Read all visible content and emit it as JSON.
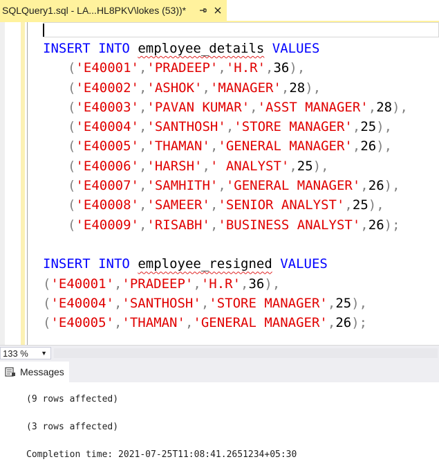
{
  "tab": {
    "title": "SQLQuery1.sql - LA...HL8PKV\\lokes (53))*",
    "pin_icon": "pin-icon",
    "close_icon": "close-icon",
    "accent": "#fff29d"
  },
  "editor": {
    "lines": [
      {
        "indent": false,
        "tokens": [
          {
            "t": "INSERT",
            "c": "kw"
          },
          {
            "t": " ",
            "c": ""
          },
          {
            "t": "INTO",
            "c": "kw"
          },
          {
            "t": " ",
            "c": ""
          },
          {
            "t": "employee_details",
            "c": "id"
          },
          {
            "t": " ",
            "c": ""
          },
          {
            "t": "VALUES",
            "c": "kw"
          }
        ]
      },
      {
        "indent": true,
        "tokens": [
          {
            "t": "(",
            "c": "op"
          },
          {
            "t": "'E40001'",
            "c": "str"
          },
          {
            "t": ",",
            "c": "op"
          },
          {
            "t": "'PRADEEP'",
            "c": "str"
          },
          {
            "t": ",",
            "c": "op"
          },
          {
            "t": "'H.R'",
            "c": "str"
          },
          {
            "t": ",",
            "c": "op"
          },
          {
            "t": "36",
            "c": "num"
          },
          {
            "t": "),",
            "c": "op"
          }
        ]
      },
      {
        "indent": true,
        "tokens": [
          {
            "t": "(",
            "c": "op"
          },
          {
            "t": "'E40002'",
            "c": "str"
          },
          {
            "t": ",",
            "c": "op"
          },
          {
            "t": "'ASHOK'",
            "c": "str"
          },
          {
            "t": ",",
            "c": "op"
          },
          {
            "t": "'MANAGER'",
            "c": "str"
          },
          {
            "t": ",",
            "c": "op"
          },
          {
            "t": "28",
            "c": "num"
          },
          {
            "t": "),",
            "c": "op"
          }
        ]
      },
      {
        "indent": true,
        "tokens": [
          {
            "t": "(",
            "c": "op"
          },
          {
            "t": "'E40003'",
            "c": "str"
          },
          {
            "t": ",",
            "c": "op"
          },
          {
            "t": "'PAVAN KUMAR'",
            "c": "str"
          },
          {
            "t": ",",
            "c": "op"
          },
          {
            "t": "'ASST MANAGER'",
            "c": "str"
          },
          {
            "t": ",",
            "c": "op"
          },
          {
            "t": "28",
            "c": "num"
          },
          {
            "t": "),",
            "c": "op"
          }
        ]
      },
      {
        "indent": true,
        "tokens": [
          {
            "t": "(",
            "c": "op"
          },
          {
            "t": "'E40004'",
            "c": "str"
          },
          {
            "t": ",",
            "c": "op"
          },
          {
            "t": "'SANTHOSH'",
            "c": "str"
          },
          {
            "t": ",",
            "c": "op"
          },
          {
            "t": "'STORE MANAGER'",
            "c": "str"
          },
          {
            "t": ",",
            "c": "op"
          },
          {
            "t": "25",
            "c": "num"
          },
          {
            "t": "),",
            "c": "op"
          }
        ]
      },
      {
        "indent": true,
        "tokens": [
          {
            "t": "(",
            "c": "op"
          },
          {
            "t": "'E40005'",
            "c": "str"
          },
          {
            "t": ",",
            "c": "op"
          },
          {
            "t": "'THAMAN'",
            "c": "str"
          },
          {
            "t": ",",
            "c": "op"
          },
          {
            "t": "'GENERAL MANAGER'",
            "c": "str"
          },
          {
            "t": ",",
            "c": "op"
          },
          {
            "t": "26",
            "c": "num"
          },
          {
            "t": "),",
            "c": "op"
          }
        ]
      },
      {
        "indent": true,
        "tokens": [
          {
            "t": "(",
            "c": "op"
          },
          {
            "t": "'E40006'",
            "c": "str"
          },
          {
            "t": ",",
            "c": "op"
          },
          {
            "t": "'HARSH'",
            "c": "str"
          },
          {
            "t": ",",
            "c": "op"
          },
          {
            "t": "' ANALYST'",
            "c": "str"
          },
          {
            "t": ",",
            "c": "op"
          },
          {
            "t": "25",
            "c": "num"
          },
          {
            "t": "),",
            "c": "op"
          }
        ]
      },
      {
        "indent": true,
        "tokens": [
          {
            "t": "(",
            "c": "op"
          },
          {
            "t": "'E40007'",
            "c": "str"
          },
          {
            "t": ",",
            "c": "op"
          },
          {
            "t": "'SAMHITH'",
            "c": "str"
          },
          {
            "t": ",",
            "c": "op"
          },
          {
            "t": "'GENERAL MANAGER'",
            "c": "str"
          },
          {
            "t": ",",
            "c": "op"
          },
          {
            "t": "26",
            "c": "num"
          },
          {
            "t": "),",
            "c": "op"
          }
        ]
      },
      {
        "indent": true,
        "tokens": [
          {
            "t": "(",
            "c": "op"
          },
          {
            "t": "'E40008'",
            "c": "str"
          },
          {
            "t": ",",
            "c": "op"
          },
          {
            "t": "'SAMEER'",
            "c": "str"
          },
          {
            "t": ",",
            "c": "op"
          },
          {
            "t": "'SENIOR ANALYST'",
            "c": "str"
          },
          {
            "t": ",",
            "c": "op"
          },
          {
            "t": "25",
            "c": "num"
          },
          {
            "t": "),",
            "c": "op"
          }
        ]
      },
      {
        "indent": true,
        "tokens": [
          {
            "t": "(",
            "c": "op"
          },
          {
            "t": "'E40009'",
            "c": "str"
          },
          {
            "t": ",",
            "c": "op"
          },
          {
            "t": "'RISABH'",
            "c": "str"
          },
          {
            "t": ",",
            "c": "op"
          },
          {
            "t": "'BUSINESS ANALYST'",
            "c": "str"
          },
          {
            "t": ",",
            "c": "op"
          },
          {
            "t": "26",
            "c": "num"
          },
          {
            "t": ");",
            "c": "op"
          }
        ]
      },
      {
        "indent": false,
        "tokens": []
      },
      {
        "indent": false,
        "tokens": [
          {
            "t": "INSERT",
            "c": "kw"
          },
          {
            "t": " ",
            "c": ""
          },
          {
            "t": "INTO",
            "c": "kw"
          },
          {
            "t": " ",
            "c": ""
          },
          {
            "t": "employee_resigned",
            "c": "id"
          },
          {
            "t": " ",
            "c": ""
          },
          {
            "t": "VALUES",
            "c": "kw"
          }
        ]
      },
      {
        "indent": false,
        "tokens": [
          {
            "t": "(",
            "c": "op"
          },
          {
            "t": "'E40001'",
            "c": "str"
          },
          {
            "t": ",",
            "c": "op"
          },
          {
            "t": "'PRADEEP'",
            "c": "str"
          },
          {
            "t": ",",
            "c": "op"
          },
          {
            "t": "'H.R'",
            "c": "str"
          },
          {
            "t": ",",
            "c": "op"
          },
          {
            "t": "36",
            "c": "num"
          },
          {
            "t": "),",
            "c": "op"
          }
        ]
      },
      {
        "indent": false,
        "tokens": [
          {
            "t": "(",
            "c": "op"
          },
          {
            "t": "'E40004'",
            "c": "str"
          },
          {
            "t": ",",
            "c": "op"
          },
          {
            "t": "'SANTHOSH'",
            "c": "str"
          },
          {
            "t": ",",
            "c": "op"
          },
          {
            "t": "'STORE MANAGER'",
            "c": "str"
          },
          {
            "t": ",",
            "c": "op"
          },
          {
            "t": "25",
            "c": "num"
          },
          {
            "t": "),",
            "c": "op"
          }
        ]
      },
      {
        "indent": false,
        "tokens": [
          {
            "t": "(",
            "c": "op"
          },
          {
            "t": "'E40005'",
            "c": "str"
          },
          {
            "t": ",",
            "c": "op"
          },
          {
            "t": "'THAMAN'",
            "c": "str"
          },
          {
            "t": ",",
            "c": "op"
          },
          {
            "t": "'GENERAL MANAGER'",
            "c": "str"
          },
          {
            "t": ",",
            "c": "op"
          },
          {
            "t": "26",
            "c": "num"
          },
          {
            "t": ");",
            "c": "op"
          }
        ]
      }
    ],
    "colors": {
      "keyword": "#0000ff",
      "string": "#e00000",
      "operator": "#808080",
      "squiggle": "#e02020"
    }
  },
  "zoom": {
    "value": "133 %",
    "dropdown_icon": "chevron-down-icon"
  },
  "results": {
    "tab_label": "Messages",
    "tab_icon": "messages-icon",
    "messages": [
      "(9 rows affected)",
      "(3 rows affected)",
      "Completion time: 2021-07-25T11:08:41.2651234+05:30"
    ]
  }
}
